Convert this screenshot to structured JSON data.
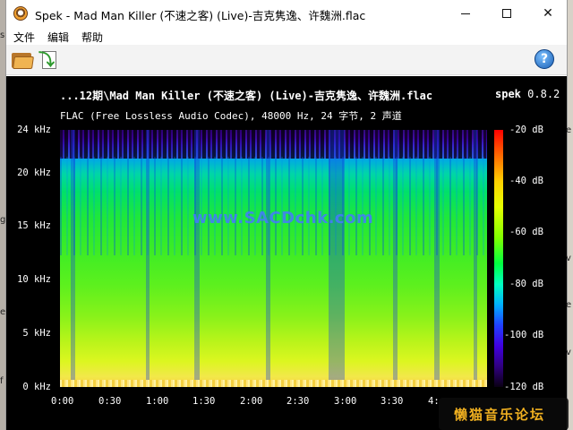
{
  "window": {
    "title": "Spek - Mad Man Killer (不速之客) (Live)-吉克隽逸、许魏洲.flac",
    "controls": {
      "minimize_icon": "minimize-icon",
      "maximize_icon": "maximize-icon",
      "close_label": "✕"
    }
  },
  "menu": {
    "items": [
      "文件",
      "编辑",
      "帮助"
    ]
  },
  "toolbar": {
    "open_icon": "folder-open-icon",
    "reload_icon": "reload-icon",
    "help_label": "?"
  },
  "spectrogram": {
    "file_title": "...12期\\Mad Man Killer (不速之客) (Live)-吉克隽逸、许魏洲.flac",
    "app_name": "spek",
    "app_version": "0.8.2",
    "file_info": "FLAC (Free Lossless Audio Codec), 48000 Hz, 24 字节, 2 声道",
    "watermark": "www.SACDchk.com",
    "freq_ticks": [
      "24 kHz",
      "20 kHz",
      "15 kHz",
      "10 kHz",
      "5 kHz",
      "0 kHz"
    ],
    "time_ticks": [
      "0:00",
      "0:30",
      "1:00",
      "1:30",
      "2:00",
      "2:30",
      "3:00",
      "3:30",
      "4:"
    ],
    "db_ticks": [
      "-20 dB",
      "-40 dB",
      "-60 dB",
      "-80 dB",
      "-100 dB",
      "-120 dB"
    ]
  },
  "overlay": {
    "forum_badge": "懒猫音乐论坛"
  },
  "desktop": {
    "left_glyphs": [
      "s",
      "g",
      "e",
      "f"
    ],
    "right_glyphs": [
      "e",
      "v",
      "e",
      "v"
    ]
  }
}
